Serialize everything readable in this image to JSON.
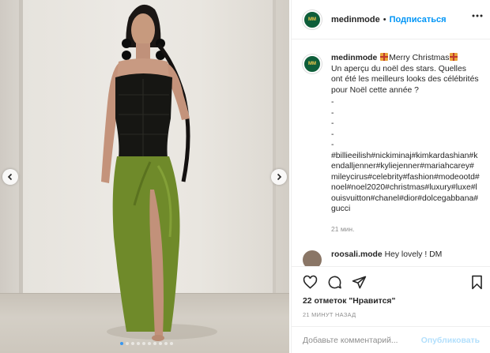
{
  "post": {
    "author": "medinmode",
    "avatar_text": "MM"
  },
  "header": {
    "username": "medinmode",
    "separator": "•",
    "follow_label": "Подписаться"
  },
  "caption": {
    "username": "medinmode",
    "headline": "Merry Christmas",
    "text": "Un aperçu du noël des stars. Quelles ont été les meilleurs looks des célébrités pour Noël cette année ?",
    "dashes": [
      "-",
      "-",
      "-",
      "-",
      "-"
    ],
    "hashtags": "#billieeilish#nickiminaj#kimkardashian#kendalljenner#kyliejenner#mariahcarey#mileycirus#celebrity#fashion#modeootd#noel#noel2020#christmas#luxury#luxe#louisvuitton#chanel#dior#dolcegabbana#gucci",
    "time": "21 мин."
  },
  "comment": {
    "username": "roosali.mode",
    "text": "Hey lovely ! DM"
  },
  "stats": {
    "likes": "22 отметок \"Нравится\"",
    "posted_ago": "21 МИНУТ НАЗАД"
  },
  "add_comment": {
    "placeholder": "Добавьте комментарий...",
    "post_label": "Опубликовать"
  },
  "carousel": {
    "count": 10,
    "active_index": 0
  },
  "colors": {
    "accent": "#0095f6",
    "hashtag": "#00376b",
    "muted": "#8e8e8e",
    "active_dot": "#3897f0"
  }
}
